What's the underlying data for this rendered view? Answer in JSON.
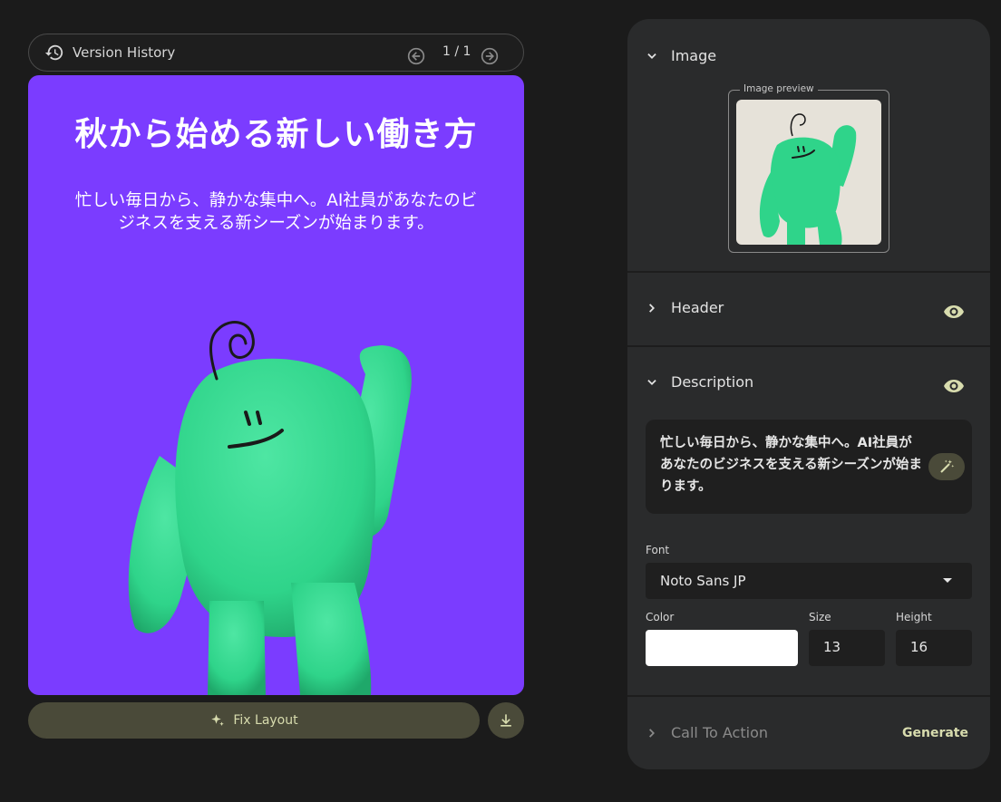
{
  "version_bar": {
    "title": "Version History",
    "counter": "1 / 1"
  },
  "canvas": {
    "header": "秋から始める新しい働き方",
    "description": "忙しい毎日から、静かな集中へ。AI社員があなたのビジネスを支える新シーズンが始まります。",
    "background_color": "#7b3cff"
  },
  "actions": {
    "fix_layout_label": "Fix Layout"
  },
  "panel": {
    "image_section": {
      "title": "Image",
      "preview_label": "Image preview"
    },
    "header_section": {
      "title": "Header"
    },
    "description_section": {
      "title": "Description",
      "text": "忙しい毎日から、静かな集中へ。AI社員があなたのビジネスを支える新シーズンが始まります。",
      "font_label": "Font",
      "font_value": "Noto Sans JP",
      "color_label": "Color",
      "color_value": "#ffffff",
      "size_label": "Size",
      "size_value": "13",
      "height_label": "Height",
      "height_value": "16"
    },
    "cta_section": {
      "title": "Call To Action",
      "generate_label": "Generate"
    }
  },
  "colors": {
    "accent": "#d8dcae",
    "character_green": "#2fd48a"
  }
}
